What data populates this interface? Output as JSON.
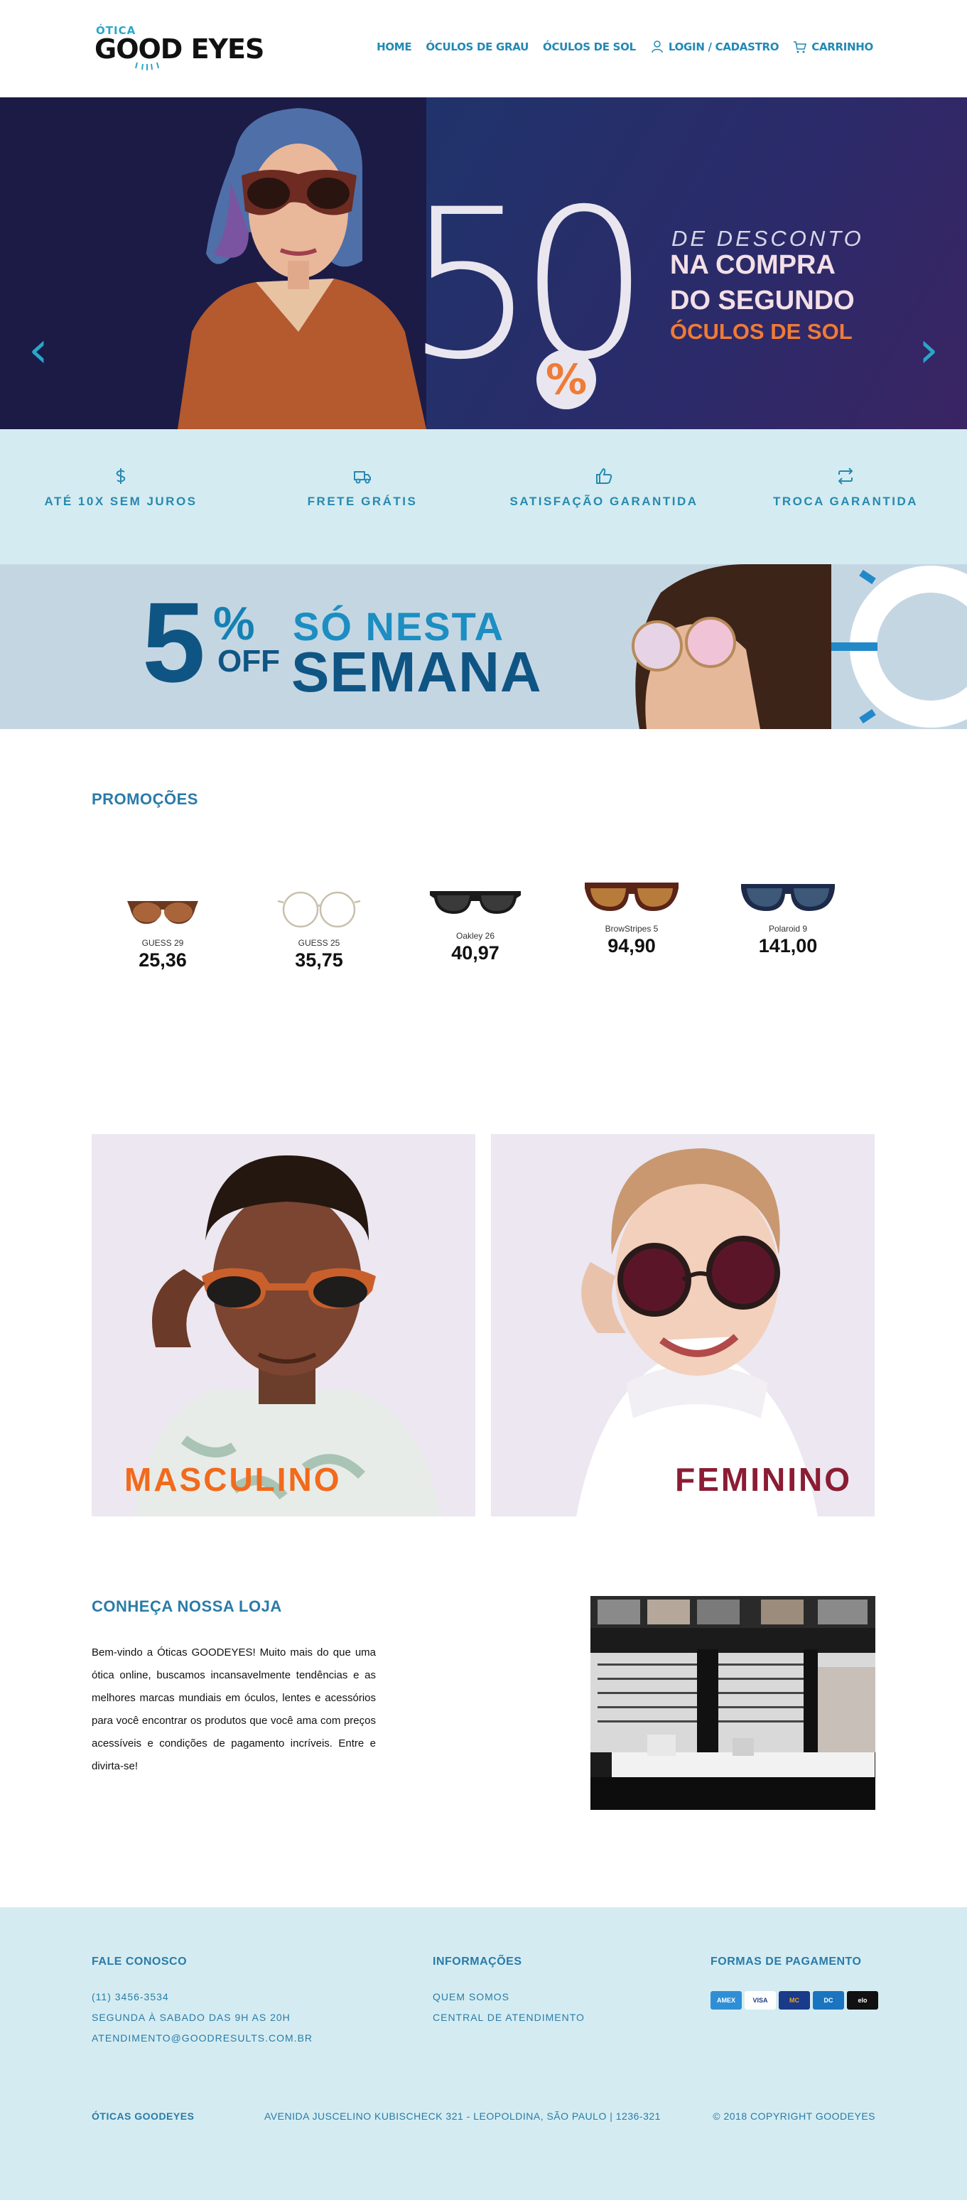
{
  "header": {
    "logo_small": "ÓTICA",
    "logo_big": "GOOD EYES",
    "nav": [
      {
        "label": "HOME",
        "icon": ""
      },
      {
        "label": "ÓCULOS DE GRAU",
        "icon": ""
      },
      {
        "label": "ÓCULOS DE SOL",
        "icon": ""
      },
      {
        "label": "LOGIN / CADASTRO",
        "icon": "user-icon"
      },
      {
        "label": "CARRINHO",
        "icon": "cart-icon"
      }
    ]
  },
  "hero": {
    "big_number": "50",
    "percent": "%",
    "line1": "DE DESCONTO",
    "line2": "NA COMPRA",
    "line3": "DO SEGUNDO",
    "line4": "ÓCULOS DE SOL",
    "prev": "‹",
    "next": "›"
  },
  "features": [
    {
      "label": "ATÉ 10X SEM JUROS",
      "icon": "dollar-icon"
    },
    {
      "label": "FRETE GRÁTIS",
      "icon": "truck-icon"
    },
    {
      "label": "SATISFAÇÃO GARANTIDA",
      "icon": "thumbs-up-icon"
    },
    {
      "label": "TROCA GARANTIDA",
      "icon": "exchange-icon"
    }
  ],
  "promo_banner": {
    "number": "5",
    "percent": "%",
    "off": "OFF",
    "line1": "SÓ NESTA",
    "line2": "SEMANA"
  },
  "promotions": {
    "title": "PROMOÇÕES",
    "products": [
      {
        "name": "GUESS 29",
        "price": "25,36"
      },
      {
        "name": "GUESS 25",
        "price": "35,75"
      },
      {
        "name": "Oakley 26",
        "price": "40,97"
      },
      {
        "name": "BrowStripes 5",
        "price": "94,90"
      },
      {
        "name": "Polaroid 9",
        "price": "141,00"
      }
    ]
  },
  "categories": {
    "masculino": "MASCULINO",
    "feminino": "FEMININO"
  },
  "about": {
    "title": "CONHEÇA NOSSA LOJA",
    "text": "Bem-vindo a Óticas GOODEYES! Muito mais do que uma ótica online, buscamos incansavelmente tendências e as melhores marcas mundiais em óculos, lentes e acessórios para você encontrar os produtos que você ama com preços acessíveis e condições de pagamento incríveis. Entre e divirta-se!"
  },
  "footer": {
    "contact_title": "FALE CONOSCO",
    "phone": "(11) 3456-3534",
    "hours": "SEGUNDA À SABADO DAS 9H AS 20H",
    "email": "ATENDIMENTO@GOODRESULTS.COM.BR",
    "info_title": "INFORMAÇÕES",
    "info_links": [
      "QUEM SOMOS",
      "CENTRAL DE ATENDIMENTO"
    ],
    "payment_title": "FORMAS DE PAGAMENTO",
    "payment_methods": [
      "AMEX",
      "VISA",
      "MC",
      "DC",
      "elo"
    ],
    "brand": "ÓTICAS GOODEYES",
    "address": "AVENIDA JUSCELINO KUBISCHECK 321 - LEOPOLDINA, SÃO PAULO | 1236-321",
    "copyright": "© 2018 COPYRIGHT GOODEYES"
  },
  "colors": {
    "accent": "#2289b4",
    "light_bg": "#d4ecf1",
    "orange": "#f07b35",
    "masc_label": "#f26a1b",
    "fem_label": "#8b1c33"
  }
}
